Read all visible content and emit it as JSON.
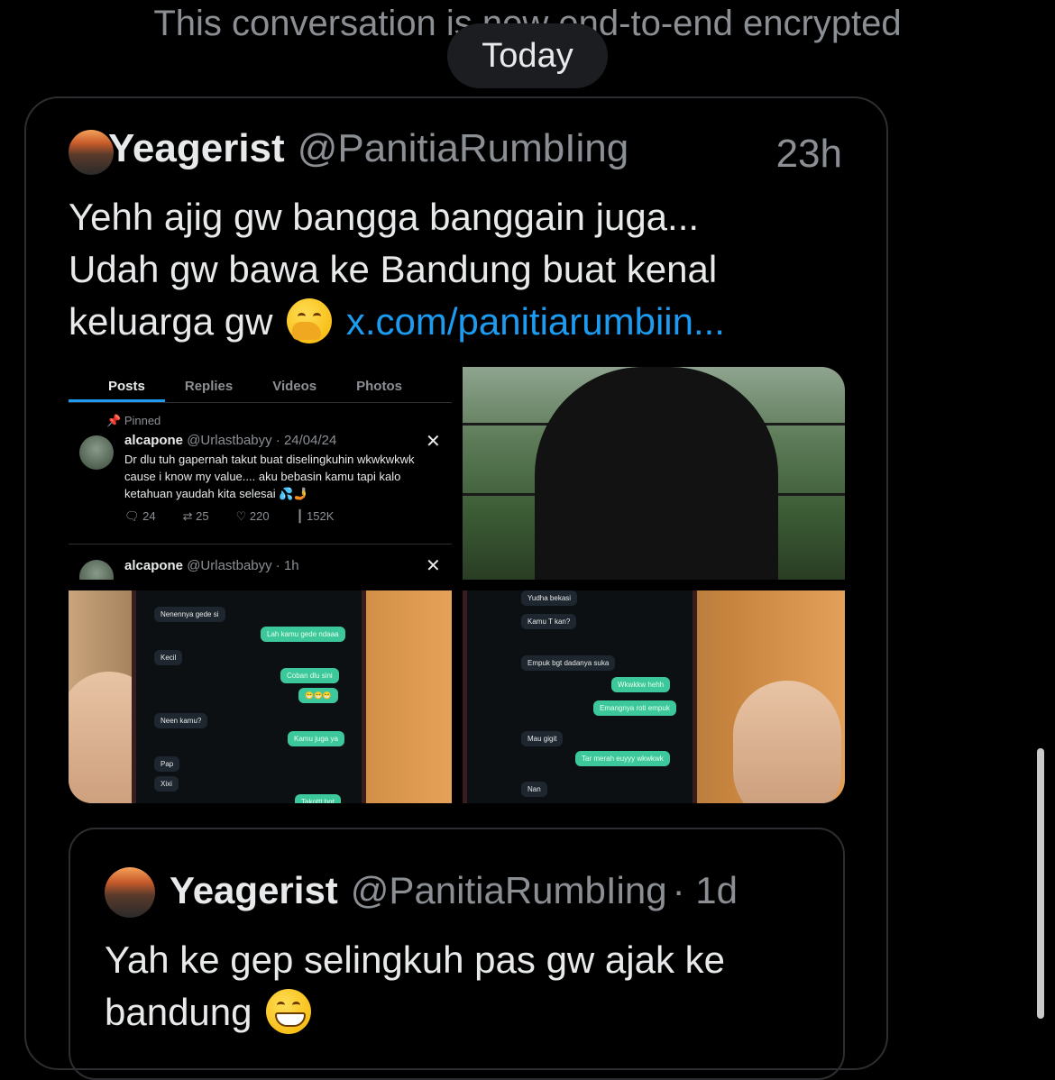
{
  "conversation": {
    "encryption_notice": "This conversation is now end-to-end encrypted",
    "date_divider": "Today"
  },
  "tweet": {
    "author_name": "Yeagerist",
    "author_handle": "@PanitiaRumbIing",
    "time": "23h",
    "text_line1": "Yehh ajig gw bangga banggain juga...",
    "text_line2": "Udah gw bawa ke Bandung buat kenal",
    "text_line3": "keluarga gw",
    "emoji": "yawning-face-emoji",
    "link": "x.com/panitiarumbiin..."
  },
  "media": {
    "screenshot": {
      "tabs": [
        "Posts",
        "Replies",
        "Videos",
        "Photos"
      ],
      "pinned_label": "Pinned",
      "post1": {
        "name": "alcapone",
        "handle_date": "@Urlastbabyy · 24/04/24",
        "text": "Dr dlu tuh gapernah takut buat diselingkuhin wkwkwkwk cause i know my value.... aku bebasin kamu tapi kalo ketahuan yaudah kita selesai 💦🤳",
        "replies": "24",
        "reposts": "25",
        "likes": "220",
        "views": "152K"
      },
      "post2": {
        "name": "alcapone",
        "handle_date": "@Urlastbabyy · 1h"
      }
    },
    "chat1": {
      "messages": [
        {
          "side": "in",
          "text": "Nenennya gede si"
        },
        {
          "side": "out",
          "text": "Lah kamu gede ndaaa"
        },
        {
          "side": "in",
          "text": "Kecil"
        },
        {
          "side": "out",
          "text": "Coban dlu sini"
        },
        {
          "side": "out",
          "text": "😁😁😁"
        },
        {
          "side": "in",
          "text": "Neen kamu?"
        },
        {
          "side": "out",
          "text": "Kamu juga ya"
        },
        {
          "side": "in",
          "text": "Pap"
        },
        {
          "side": "in",
          "text": "Xixi"
        },
        {
          "side": "out",
          "text": "Takottt bgt"
        }
      ]
    },
    "chat2": {
      "messages": [
        {
          "side": "in",
          "text": "Yudha bekasi"
        },
        {
          "side": "in",
          "text": "Kamu T kan?"
        },
        {
          "side": "in",
          "text": "Empuk bgt dadanya suka"
        },
        {
          "side": "out",
          "text": "Wkwkkw hehh"
        },
        {
          "side": "out",
          "text": "Emangnya roti empuk"
        },
        {
          "side": "in",
          "text": "Mau gigit"
        },
        {
          "side": "out",
          "text": "Tar merah euyyy wkwkwk"
        },
        {
          "side": "in",
          "text": "Nan"
        }
      ]
    }
  },
  "quoted": {
    "author_name": "Yeagerist",
    "author_handle": "@PanitiaRumbIing",
    "time": "· 1d",
    "text_line1": "Yah ke gep selingkuh pas gw ajak ke",
    "text_line2": "bandung",
    "emoji": "grinning-face-emoji"
  },
  "colors": {
    "background": "#000000",
    "text": "#e7e9ea",
    "muted": "#8b8f94",
    "link": "#1d9bf0"
  }
}
